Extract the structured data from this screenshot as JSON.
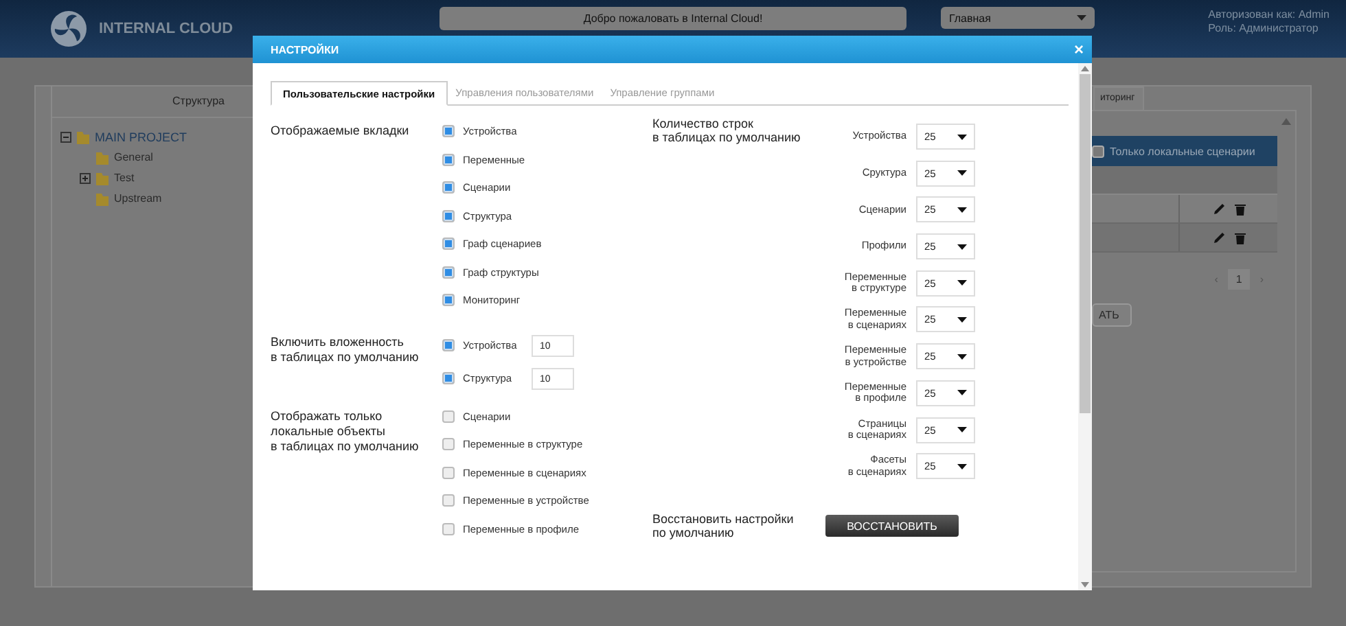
{
  "header": {
    "logo_text": "INTERNAL CLOUD",
    "welcome": "Добро пожаловать в Internal Cloud!",
    "page_select": "Главная",
    "auth": [
      "Авторизован как: Admin",
      "Роль: Администратор"
    ]
  },
  "structure_panel": {
    "title": "Структура",
    "tree": [
      {
        "label": "MAIN PROJECT",
        "expanded": true,
        "children": [
          {
            "label": "General"
          },
          {
            "label": "Test",
            "expanded": false
          },
          {
            "label": "Upstream"
          }
        ]
      }
    ]
  },
  "right_panel": {
    "tab": "иторинг",
    "filter": {
      "label": "Только локальные сценарии",
      "checked": false
    },
    "pager": {
      "prev": "‹",
      "page": "1",
      "next": "›"
    },
    "button": "АТЬ"
  },
  "dialog": {
    "title": "НАСТРОЙКИ",
    "close": "×",
    "tabs": [
      {
        "label": "Пользовательские настройки",
        "selected": true
      },
      {
        "label": "Управления пользователями",
        "selected": false
      },
      {
        "label": "Управление группами",
        "selected": false
      }
    ],
    "visible_tabs": {
      "label": "Отображаемые вкладки",
      "options": [
        {
          "label": "Устройства",
          "checked": true
        },
        {
          "label": "Переменные",
          "checked": true
        },
        {
          "label": "Сценарии",
          "checked": true
        },
        {
          "label": "Структура",
          "checked": true
        },
        {
          "label": "Граф сценариев",
          "checked": true
        },
        {
          "label": "Граф структуры",
          "checked": true
        },
        {
          "label": "Мониторинг",
          "checked": true
        }
      ]
    },
    "nesting": {
      "label": "Включить вложенность\nв таблицах по умолчанию",
      "options": [
        {
          "label": "Устройства",
          "checked": true,
          "value": "10"
        },
        {
          "label": "Структура",
          "checked": true,
          "value": "10"
        }
      ]
    },
    "local_only": {
      "label": "Отображать только\nлокальные объекты\nв таблицах по умолчанию",
      "options": [
        {
          "label": "Сценарии",
          "checked": false
        },
        {
          "label": "Переменные в структуре",
          "checked": false
        },
        {
          "label": "Переменные в сценариях",
          "checked": false
        },
        {
          "label": "Переменные в устройстве",
          "checked": false
        },
        {
          "label": "Переменные в профиле",
          "checked": false
        }
      ]
    },
    "rows_count": {
      "label": "Количество строк\nв таблицах по умолчанию",
      "fields": [
        {
          "label": "Устройства",
          "value": "25"
        },
        {
          "label": "Сруктура",
          "value": "25"
        },
        {
          "label": "Сценарии",
          "value": "25"
        },
        {
          "label": "Профили",
          "value": "25"
        },
        {
          "label": "Переменные\nв структуре",
          "value": "25"
        },
        {
          "label": "Переменные\nв сценариях",
          "value": "25"
        },
        {
          "label": "Переменные\nв устройстве",
          "value": "25"
        },
        {
          "label": "Переменные\nв профиле",
          "value": "25"
        },
        {
          "label": "Страницы\nв сценариях",
          "value": "25"
        },
        {
          "label": "Фасеты\nв сценариях",
          "value": "25"
        }
      ]
    },
    "restore": {
      "label": "Восстановить настройки\nпо умолчанию",
      "button": "ВОССТАНОВИТЬ"
    }
  }
}
